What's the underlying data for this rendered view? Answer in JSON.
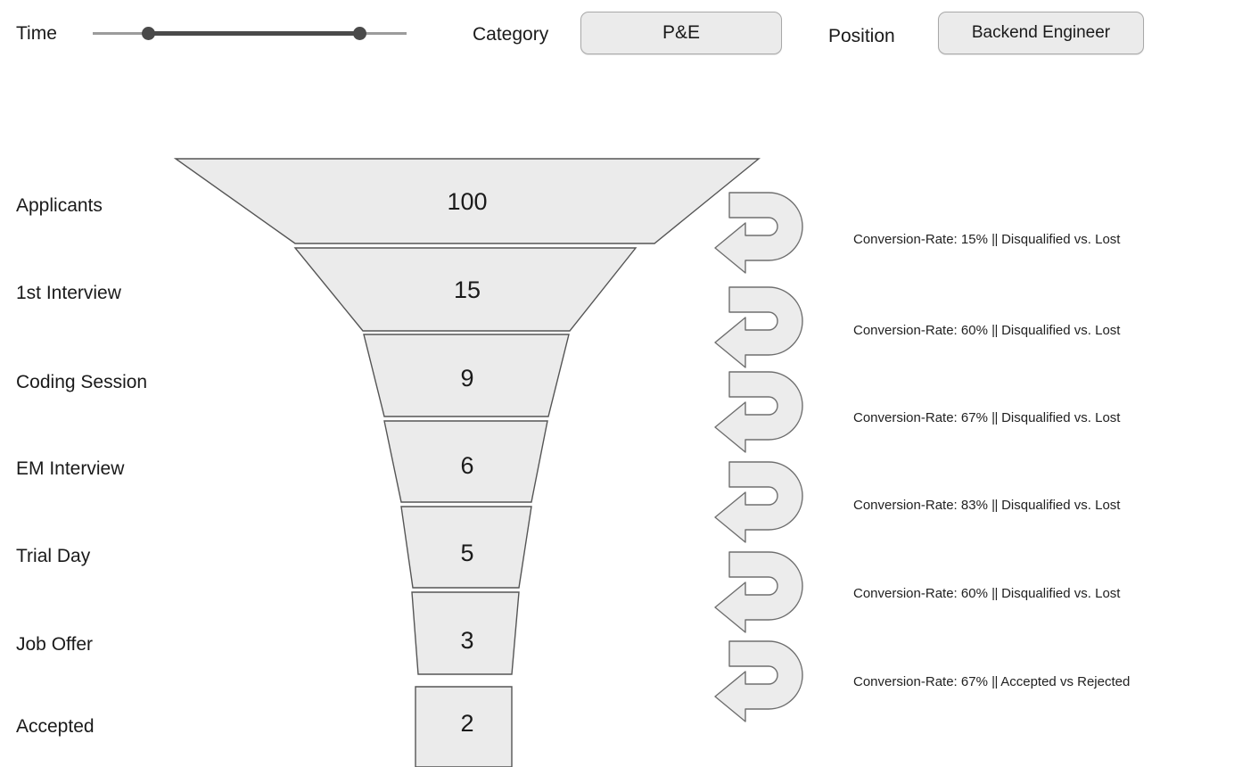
{
  "toolbar": {
    "time": {
      "label": "Time",
      "slider_icon": "range-slider-icon",
      "low_handle": "slider-handle-low",
      "high_handle": "slider-handle-high"
    },
    "category": {
      "label": "Category",
      "value": "P&E"
    },
    "position": {
      "label": "Position",
      "value": "Backend Engineer"
    }
  },
  "chart_data": {
    "type": "funnel",
    "title": "",
    "xlabel": "",
    "ylabel": "",
    "categories": [
      "Applicants",
      "1st Interview",
      "Coding Session",
      "EM Interview",
      "Trial Day",
      "Job Offer",
      "Accepted"
    ],
    "values": [
      100,
      15,
      9,
      6,
      5,
      3,
      2
    ],
    "value_labels": [
      "100",
      "15",
      "9",
      "6",
      "5",
      "3",
      "2"
    ],
    "transitions": [
      {
        "from": "Applicants",
        "to": "1st Interview",
        "rate": "15%",
        "rate_value": 15,
        "breakdown": "Disqualified vs. Lost",
        "label": "Conversion-Rate: 15%",
        "separator": "||",
        "arrow_icon": "u-turn-arrow-icon"
      },
      {
        "from": "1st Interview",
        "to": "Coding Session",
        "rate": "60%",
        "rate_value": 60,
        "breakdown": "Disqualified vs. Lost",
        "label": "Conversion-Rate: 60%",
        "separator": "||",
        "arrow_icon": "u-turn-arrow-icon"
      },
      {
        "from": "Coding Session",
        "to": "EM Interview",
        "rate": "67%",
        "rate_value": 67,
        "breakdown": "Disqualified vs. Lost",
        "label": "Conversion-Rate: 67%",
        "separator": "||",
        "arrow_icon": "u-turn-arrow-icon"
      },
      {
        "from": "EM Interview",
        "to": "Trial Day",
        "rate": "83%",
        "rate_value": 83,
        "breakdown": "Disqualified vs. Lost",
        "label": "Conversion-Rate: 83%",
        "separator": "||",
        "arrow_icon": "u-turn-arrow-icon"
      },
      {
        "from": "Trial Day",
        "to": "Job Offer",
        "rate": "60%",
        "rate_value": 60,
        "breakdown": "Disqualified vs. Lost",
        "label": "Conversion-Rate: 60%",
        "separator": "||",
        "arrow_icon": "u-turn-arrow-icon"
      },
      {
        "from": "Job Offer",
        "to": "Accepted",
        "rate": "67%",
        "rate_value": 67,
        "breakdown": "Accepted vs Rejected",
        "label": "Conversion-Rate: 67%",
        "separator": "||",
        "arrow_icon": "u-turn-arrow-icon"
      }
    ],
    "colors": {
      "segment_fill": "#ebebeb",
      "segment_stroke": "#555555",
      "arrow_fill": "#ececec",
      "arrow_stroke": "#6e6e6e",
      "text": "#1a1a1a",
      "slider_track": "#9b9b9b",
      "slider_range": "#4a4a4a"
    }
  }
}
